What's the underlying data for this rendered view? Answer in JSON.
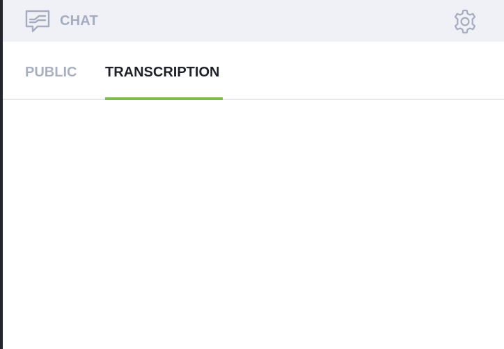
{
  "header": {
    "title": "CHAT",
    "icon": "chat-icon",
    "settings_icon": "gear-icon"
  },
  "tabs": [
    {
      "label": "PUBLIC",
      "active": false
    },
    {
      "label": "TRANSCRIPTION",
      "active": true
    }
  ],
  "colors": {
    "header_bg": "#f0f1f6",
    "muted_text": "#a5acc0",
    "active_text": "#1e2128",
    "accent": "#7dba4f"
  }
}
